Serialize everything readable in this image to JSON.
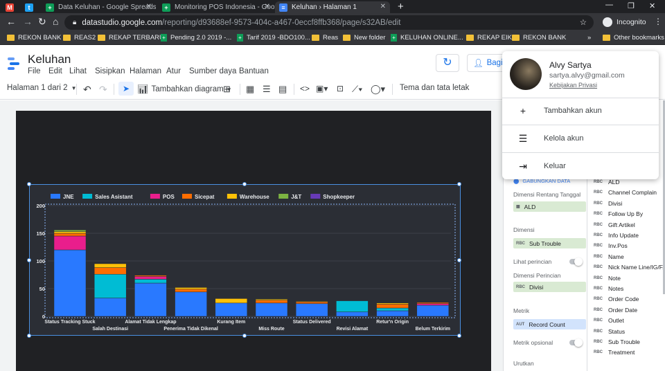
{
  "browser": {
    "tabs": [
      {
        "label": "",
        "icon": "gmail-icon"
      },
      {
        "label": "",
        "icon": "twitter-icon"
      },
      {
        "label": "Data Keluhan - Google Spreadsh",
        "icon": "sheets-icon"
      },
      {
        "label": "Monitoring POS Indonesia - Goo",
        "icon": "sheets-icon"
      },
      {
        "label": "Keluhan › Halaman 1",
        "icon": "datastudio-icon"
      }
    ],
    "url_domain": "datastudio.google.com",
    "url_path": "/reporting/d93688ef-9573-404c-a467-0eccf8ffb368/page/s32AB/edit",
    "profile_label": "Incognito",
    "bookmarks": [
      {
        "label": "REKON BANK",
        "type": "folder"
      },
      {
        "label": "REAS2",
        "type": "folder"
      },
      {
        "label": "REKAP TERBARU",
        "type": "folder"
      },
      {
        "label": "Pending 2.0 2019 -...",
        "type": "sheet"
      },
      {
        "label": "Tarif 2019 -BDO100...",
        "type": "sheet"
      },
      {
        "label": "Reas",
        "type": "folder"
      },
      {
        "label": "New folder",
        "type": "folder"
      },
      {
        "label": "KELUHAN ONLINE...",
        "type": "sheet"
      },
      {
        "label": "REKAP EIK",
        "type": "folder"
      },
      {
        "label": "REKON BANK",
        "type": "folder"
      }
    ],
    "other_bookmarks": "Other bookmarks"
  },
  "app": {
    "title": "Keluhan",
    "menu": [
      "File",
      "Edit",
      "Lihat",
      "Sisipkan",
      "Halaman",
      "Atur",
      "Sumber daya",
      "Bantuan"
    ],
    "share_label": "Bagi",
    "page_indicator": "Halaman 1 dari 2",
    "add_chart_label": "Tambahkan diagram",
    "theme_label": "Tema dan tata letak"
  },
  "popup": {
    "name": "Alvy Sartya",
    "email": "sartya.alvy@gmail.com",
    "privacy": "Kebijakan Privasi",
    "items": [
      "Tambahkan akun",
      "Kelola akun",
      "Keluar"
    ]
  },
  "panel": {
    "blend_label": "GABUNGKAN DATA",
    "date_dim_label": "Dimensi Rentang Tanggal",
    "date_dim_value": "ALD",
    "dim_label": "Dimensi",
    "dim_value": "Sub Trouble",
    "drill_label": "Lihat perincian",
    "drill_dim_label": "Dimensi Perincian",
    "drill_dim_value": "Divisi",
    "metric_label": "Metrik",
    "metric_value": "Record Count",
    "optional_metric_label": "Metrik opsional",
    "sort_label": "Urutkan",
    "fields": [
      "ALD",
      "Channel Complain",
      "Divisi",
      "Follow Up By",
      "Gift Artikel",
      "Info Update",
      "Inv.Pos",
      "Name",
      "Nick Name Line/IG/F...",
      "Note",
      "Notes",
      "Order Code",
      "Order Date",
      "Outlet",
      "Status",
      "Sub Trouble",
      "Treatment"
    ]
  },
  "chart_data": {
    "type": "bar",
    "stacked": true,
    "categories": [
      "Status Tracking Stuck",
      "Salah Destinasi",
      "Alamat Tidak Lengkap",
      "Penerima Tidak Dikenal",
      "Kurang Item",
      "Miss Route",
      "Status Delivered",
      "Revisi Alamat",
      "Retur'n Origin",
      "Belum Terkirim"
    ],
    "yticks": [
      0,
      50,
      100,
      150,
      200
    ],
    "ylim": [
      0,
      200
    ],
    "legend_position": "top-left",
    "series": [
      {
        "name": "JNE",
        "color": "#2979ff",
        "values": [
          120,
          33,
          60,
          44,
          24,
          24,
          23,
          8,
          10,
          20
        ]
      },
      {
        "name": "Sales Asistant",
        "color": "#00bcd4",
        "values": [
          0,
          43,
          7,
          0,
          0,
          0,
          0,
          20,
          5,
          0
        ]
      },
      {
        "name": "POS",
        "color": "#e91e8c",
        "values": [
          25,
          0,
          5,
          0,
          0,
          0,
          0,
          0,
          0,
          3
        ]
      },
      {
        "name": "Sicepat",
        "color": "#ff6d00",
        "values": [
          5,
          12,
          2,
          5,
          0,
          5,
          3,
          0,
          7,
          2
        ]
      },
      {
        "name": "Warehouse",
        "color": "#ffc107",
        "values": [
          3,
          7,
          0,
          3,
          8,
          2,
          1,
          0,
          2,
          0
        ]
      },
      {
        "name": "J&T",
        "color": "#7cb342",
        "values": [
          3,
          0,
          0,
          0,
          0,
          0,
          0,
          0,
          0,
          0
        ]
      },
      {
        "name": "Shopkeeper",
        "color": "#673ab7",
        "values": [
          0,
          0,
          0,
          0,
          0,
          0,
          0,
          0,
          0,
          0
        ]
      }
    ]
  }
}
